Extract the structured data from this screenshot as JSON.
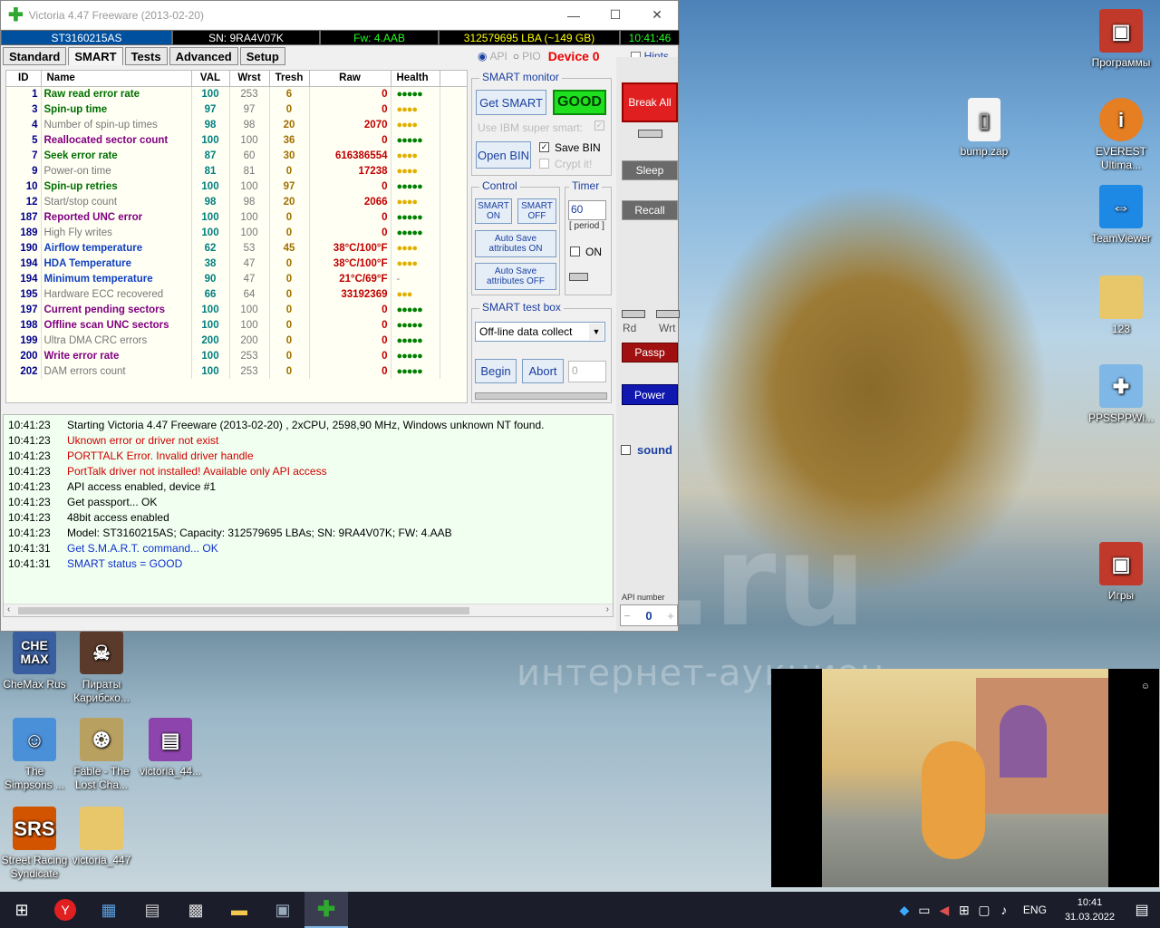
{
  "window": {
    "title": "Victoria 4.47  Freeware (2013-02-20)"
  },
  "infobar": {
    "model": "ST3160215AS",
    "sn": "SN: 9RA4V07K",
    "fw": "Fw: 4.AAB",
    "lba": "312579695 LBA (~149 GB)",
    "time": "10:41:46"
  },
  "tabs": [
    "Standard",
    "SMART",
    "Tests",
    "Advanced",
    "Setup"
  ],
  "tabright": {
    "api": "API",
    "pio": "PIO",
    "device": "Device 0",
    "hints": "Hints"
  },
  "smart": {
    "headers": [
      "ID",
      "Name",
      "VAL",
      "Wrst",
      "Tresh",
      "Raw",
      "Health"
    ],
    "rows": [
      {
        "id": "1",
        "name": "Raw read error rate",
        "val": "100",
        "wrst": "253",
        "tresh": "6",
        "raw": "0",
        "health": "●●●●●",
        "style": "green",
        "hcolor": "#008000"
      },
      {
        "id": "3",
        "name": "Spin-up time",
        "val": "97",
        "wrst": "97",
        "tresh": "0",
        "raw": "0",
        "health": "●●●●",
        "style": "green",
        "hcolor": "#e0b000"
      },
      {
        "id": "4",
        "name": "Number of spin-up times",
        "val": "98",
        "wrst": "98",
        "tresh": "20",
        "raw": "2070",
        "health": "●●●●",
        "style": "gray",
        "hcolor": "#e0b000"
      },
      {
        "id": "5",
        "name": "Reallocated sector count",
        "val": "100",
        "wrst": "100",
        "tresh": "36",
        "raw": "0",
        "health": "●●●●●",
        "style": "purple",
        "hcolor": "#008000"
      },
      {
        "id": "7",
        "name": "Seek error rate",
        "val": "87",
        "wrst": "60",
        "tresh": "30",
        "raw": "616386554",
        "health": "●●●●",
        "style": "green",
        "hcolor": "#e0b000"
      },
      {
        "id": "9",
        "name": "Power-on time",
        "val": "81",
        "wrst": "81",
        "tresh": "0",
        "raw": "17238",
        "health": "●●●●",
        "style": "gray",
        "hcolor": "#e0b000"
      },
      {
        "id": "10",
        "name": "Spin-up retries",
        "val": "100",
        "wrst": "100",
        "tresh": "97",
        "raw": "0",
        "health": "●●●●●",
        "style": "green",
        "hcolor": "#008000"
      },
      {
        "id": "12",
        "name": "Start/stop count",
        "val": "98",
        "wrst": "98",
        "tresh": "20",
        "raw": "2066",
        "health": "●●●●",
        "style": "gray",
        "hcolor": "#e0b000"
      },
      {
        "id": "187",
        "name": "Reported UNC error",
        "val": "100",
        "wrst": "100",
        "tresh": "0",
        "raw": "0",
        "health": "●●●●●",
        "style": "purple",
        "hcolor": "#008000"
      },
      {
        "id": "189",
        "name": "High Fly writes",
        "val": "100",
        "wrst": "100",
        "tresh": "0",
        "raw": "0",
        "health": "●●●●●",
        "style": "gray",
        "hcolor": "#008000"
      },
      {
        "id": "190",
        "name": "Airflow temperature",
        "val": "62",
        "wrst": "53",
        "tresh": "45",
        "raw": "38°C/100°F",
        "health": "●●●●",
        "style": "blue",
        "hcolor": "#e0b000"
      },
      {
        "id": "194",
        "name": "HDA Temperature",
        "val": "38",
        "wrst": "47",
        "tresh": "0",
        "raw": "38°C/100°F",
        "health": "●●●●",
        "style": "blue",
        "hcolor": "#e0b000"
      },
      {
        "id": "194",
        "name": "Minimum temperature",
        "val": "90",
        "wrst": "47",
        "tresh": "0",
        "raw": "21°C/69°F",
        "health": "-",
        "style": "blue",
        "hcolor": "#777"
      },
      {
        "id": "195",
        "name": "Hardware ECC recovered",
        "val": "66",
        "wrst": "64",
        "tresh": "0",
        "raw": "33192369",
        "health": "●●●",
        "style": "gray",
        "hcolor": "#e0b000"
      },
      {
        "id": "197",
        "name": "Current pending sectors",
        "val": "100",
        "wrst": "100",
        "tresh": "0",
        "raw": "0",
        "health": "●●●●●",
        "style": "purple",
        "hcolor": "#008000"
      },
      {
        "id": "198",
        "name": "Offline scan UNC sectors",
        "val": "100",
        "wrst": "100",
        "tresh": "0",
        "raw": "0",
        "health": "●●●●●",
        "style": "purple",
        "hcolor": "#008000"
      },
      {
        "id": "199",
        "name": "Ultra DMA CRC errors",
        "val": "200",
        "wrst": "200",
        "tresh": "0",
        "raw": "0",
        "health": "●●●●●",
        "style": "gray",
        "hcolor": "#008000"
      },
      {
        "id": "200",
        "name": "Write error rate",
        "val": "100",
        "wrst": "253",
        "tresh": "0",
        "raw": "0",
        "health": "●●●●●",
        "style": "purple",
        "hcolor": "#008000"
      },
      {
        "id": "202",
        "name": "DAM errors count",
        "val": "100",
        "wrst": "253",
        "tresh": "0",
        "raw": "0",
        "health": "●●●●●",
        "style": "gray",
        "hcolor": "#008000"
      }
    ]
  },
  "monitor": {
    "label": "SMART monitor",
    "get_smart": "Get SMART",
    "status": "GOOD",
    "ibm": "Use IBM super smart:",
    "open_bin": "Open BIN",
    "save_bin": "Save BIN",
    "crypt": "Crypt it!"
  },
  "control": {
    "label": "Control",
    "smart_on": "SMART ON",
    "smart_off": "SMART OFF",
    "autosave_on": "Auto Save attributes ON",
    "autosave_off": "Auto Save attributes OFF"
  },
  "timer": {
    "label": "Timer",
    "value": "60",
    "period": "[ period ]",
    "on": "ON"
  },
  "testbox": {
    "label": "SMART test box",
    "selected": "Off-line data collect",
    "begin": "Begin",
    "abort": "Abort",
    "count": "0"
  },
  "right": {
    "break_all": "Break All",
    "sleep": "Sleep",
    "recall": "Recall",
    "rd": "Rd",
    "wrt": "Wrt",
    "passp": "Passp",
    "power": "Power",
    "sound": "sound",
    "api_number_label": "API number",
    "api_number": "0"
  },
  "log": [
    {
      "t": "10:41:23",
      "msg": "Starting Victoria 4.47  Freeware (2013-02-20) , 2xCPU, 2598,90 MHz, Windows unknown NT found.",
      "color": "#000"
    },
    {
      "t": "10:41:23",
      "msg": "Uknown error or driver not exist",
      "color": "#d00000"
    },
    {
      "t": "10:41:23",
      "msg": "PORTTALK Error. Invalid driver handle",
      "color": "#d00000"
    },
    {
      "t": "10:41:23",
      "msg": "PortTalk driver not installed! Available only API access",
      "color": "#d00000"
    },
    {
      "t": "10:41:23",
      "msg": "API access enabled, device #1",
      "color": "#000"
    },
    {
      "t": "10:41:23",
      "msg": "Get passport... OK",
      "color": "#000"
    },
    {
      "t": "10:41:23",
      "msg": "48bit access enabled",
      "color": "#000"
    },
    {
      "t": "10:41:23",
      "msg": "Model: ST3160215AS; Capacity: 312579695 LBAs; SN: 9RA4V07K; FW: 4.AAB",
      "color": "#000"
    },
    {
      "t": "10:41:31",
      "msg": "Get S.M.A.R.T. command... OK",
      "color": "#1030d0"
    },
    {
      "t": "10:41:31",
      "msg": "SMART status = GOOD",
      "color": "#1030d0"
    }
  ],
  "desktop": {
    "watermark": "интернет-аукцион",
    "watermark_big": "au.ru",
    "icons_right": [
      {
        "label": "Программы",
        "icon": "folder-programs-icon",
        "color": "#c0392b"
      },
      {
        "label": "bump.zap",
        "icon": "file-icon",
        "color": "#f4f4f4"
      },
      {
        "label": "EVEREST Ultima...",
        "icon": "everest-icon",
        "color": "#e67e22"
      },
      {
        "label": "TeamViewer",
        "icon": "teamviewer-icon",
        "color": "#1e88e5"
      },
      {
        "label": "123",
        "icon": "folder-icon",
        "color": "#e8c66a"
      },
      {
        "label": "PPSSPPWi...",
        "icon": "ppsspp-icon",
        "color": "#7fb7e6"
      },
      {
        "label": "Игры",
        "icon": "folder-games-icon",
        "color": "#c0392b"
      }
    ],
    "icons_left": [
      {
        "label": "CheMax Rus",
        "icon": "chemax-icon",
        "color": "#3a5fa0"
      },
      {
        "label": "Пираты Карибско...",
        "icon": "pirates-icon",
        "color": "#5a3a2a"
      },
      {
        "label": "The Simpsons ...",
        "icon": "simpsons-icon",
        "color": "#4a90d9"
      },
      {
        "label": "Fable - The Lost Cha...",
        "icon": "fable-icon",
        "color": "#b8a060"
      },
      {
        "label": "victoria_44...",
        "icon": "winrar-icon",
        "color": "#8e44ad"
      },
      {
        "label": "Street Racing Syndicate",
        "icon": "srs-icon",
        "color": "#d35400"
      },
      {
        "label": "victoria_447",
        "icon": "folder-icon",
        "color": "#e8c66a"
      }
    ]
  },
  "taskbar": {
    "lang": "ENG",
    "time": "10:41",
    "date": "31.03.2022"
  }
}
